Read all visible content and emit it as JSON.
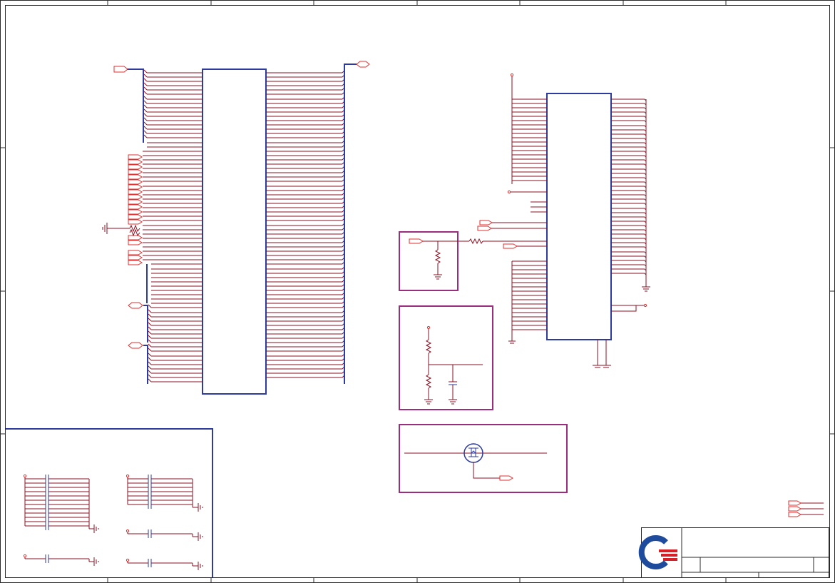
{
  "sheet": {
    "background": "#ffffff",
    "border_color": "#2a2a2a",
    "wire_color": "#8b1020",
    "signal_color": "#e03030",
    "body_color": "#2d3a9e",
    "box_color": "#9a2d7e",
    "connector_color": "#e03030"
  },
  "title_block": {
    "logo_name": "company-logo",
    "logo_colors": [
      "#1e4b9b",
      "#d61f26"
    ]
  }
}
